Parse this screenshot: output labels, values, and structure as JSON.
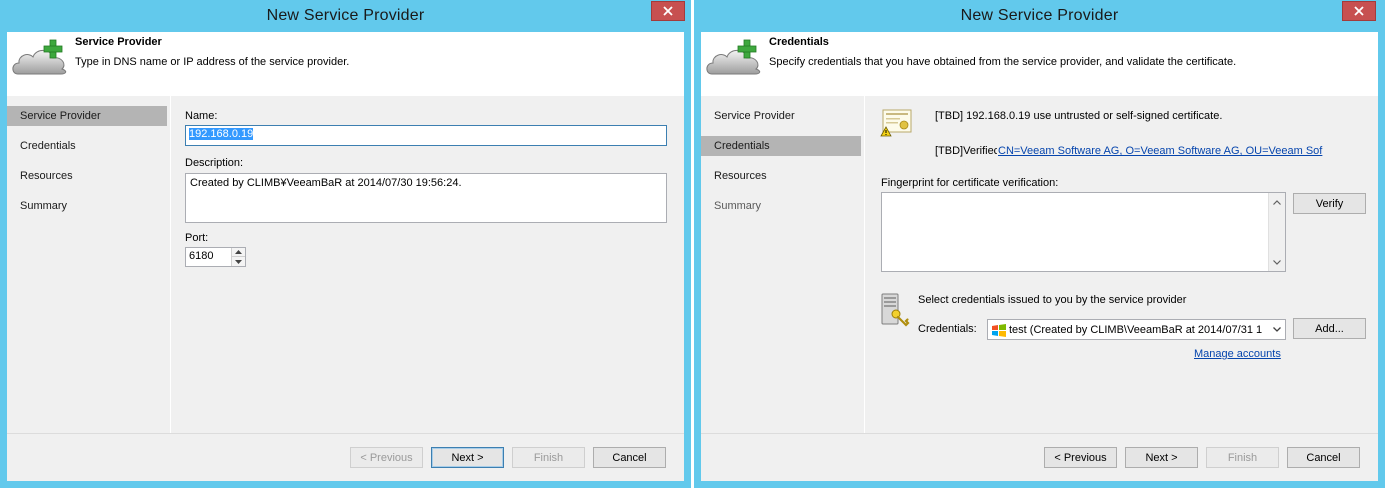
{
  "dialogs": [
    {
      "title": "New Service Provider",
      "header": {
        "title": "Service Provider",
        "description": "Type in DNS name or IP address of the service provider."
      },
      "steps": [
        {
          "label": "Service Provider",
          "state": "active"
        },
        {
          "label": "Credentials",
          "state": "normal"
        },
        {
          "label": "Resources",
          "state": "normal"
        },
        {
          "label": "Summary",
          "state": "normal"
        }
      ],
      "form": {
        "name_label": "Name:",
        "name_value": "192.168.0.19",
        "description_label": "Description:",
        "description_value": "Created by CLIMB¥VeeamBaR at 2014/07/30 19:56:24.",
        "port_label": "Port:",
        "port_value": "6180"
      },
      "buttons": {
        "previous": "< Previous",
        "next": "Next >",
        "finish": "Finish",
        "cancel": "Cancel"
      }
    },
    {
      "title": "New Service Provider",
      "header": {
        "title": "Credentials",
        "description": "Specify credentials that you have obtained from the service provider, and validate the certificate."
      },
      "steps": [
        {
          "label": "Service Provider",
          "state": "normal"
        },
        {
          "label": "Credentials",
          "state": "active"
        },
        {
          "label": "Resources",
          "state": "normal"
        },
        {
          "label": "Summary",
          "state": "dim"
        }
      ],
      "certificate": {
        "status_text": "[TBD] 192.168.0.19 use untrusted or self-signed certificate.",
        "verified_prefix": "[TBD]Verifiec",
        "verified_link": "CN=Veeam Software AG, O=Veeam Software AG, OU=Veeam Sof"
      },
      "fingerprint": {
        "label": "Fingerprint for certificate verification:",
        "value": "",
        "verify_button": "Verify"
      },
      "credentials": {
        "intro": "Select credentials issued to you by the service provider",
        "label": "Credentials:",
        "selected": "test (Created by CLIMB\\VeeamBaR at 2014/07/31 1",
        "add_button": "Add...",
        "manage_link": "Manage accounts"
      },
      "buttons": {
        "previous": "< Previous",
        "next": "Next >",
        "finish": "Finish",
        "cancel": "Cancel"
      }
    }
  ],
  "colors": {
    "frame": "#62c9ec",
    "close": "#c75050",
    "active_step": "#b4b4b4",
    "link": "#0645ad",
    "selection": "#3399ff"
  }
}
